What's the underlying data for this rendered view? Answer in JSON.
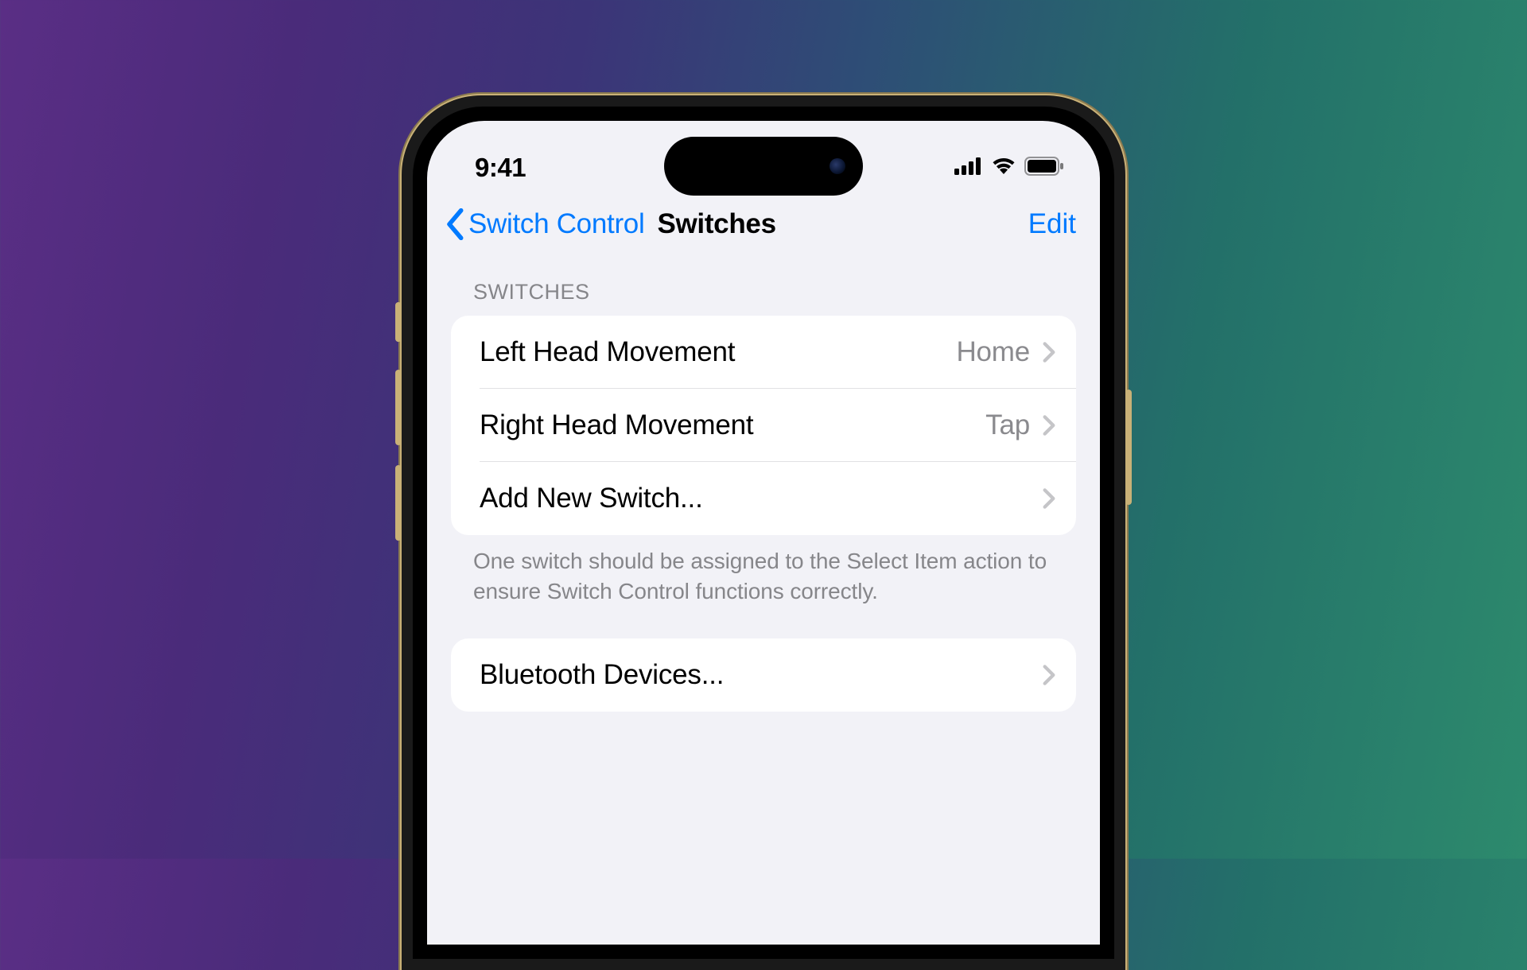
{
  "status_bar": {
    "time": "9:41"
  },
  "nav": {
    "back_label": "Switch Control",
    "title": "Switches",
    "edit_label": "Edit"
  },
  "sections": {
    "switches": {
      "header": "SWITCHES",
      "rows": [
        {
          "label": "Left Head Movement",
          "value": "Home"
        },
        {
          "label": "Right Head Movement",
          "value": "Tap"
        },
        {
          "label": "Add New Switch...",
          "value": ""
        }
      ],
      "footer": "One switch should be assigned to the Select Item action to ensure Switch Control functions correctly."
    },
    "bluetooth": {
      "rows": [
        {
          "label": "Bluetooth Devices...",
          "value": ""
        }
      ]
    }
  },
  "colors": {
    "ios_blue": "#007aff",
    "bg": "#f2f2f7",
    "secondary_text": "#86868a"
  }
}
